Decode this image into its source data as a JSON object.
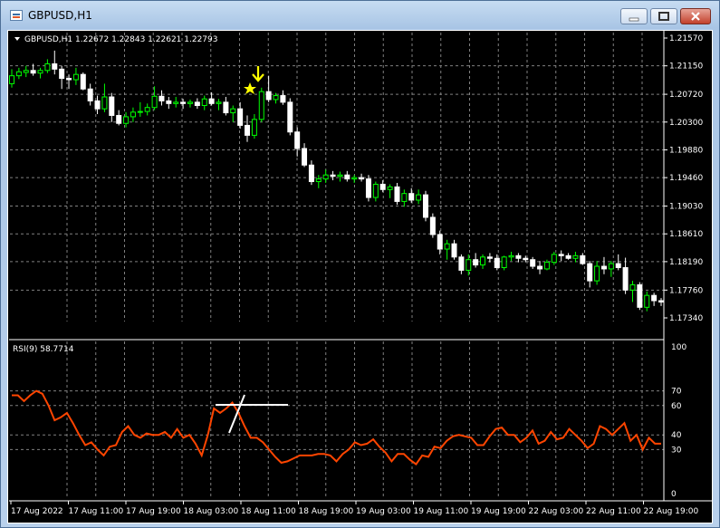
{
  "window": {
    "title": "GBPUSD,H1"
  },
  "main_panel": {
    "label": "GBPUSD,H1  1.22672 1.22843 1.22621 1.22793"
  },
  "rsi_panel": {
    "label": "RSI(9) 58.7714"
  },
  "colors": {
    "background": "#000000",
    "grid": "#808080",
    "bull": "#00ff00",
    "bear": "#ffffff",
    "rsi_line": "#ff4500",
    "arrow": "#ffff00"
  },
  "icons": {
    "signal_arrow": "arrow-down-icon",
    "signal_star": "star-icon",
    "minimize": "minimize-icon",
    "maximize": "maximize-icon",
    "close": "close-icon"
  },
  "price_axis": [
    "1.21570",
    "1.21150",
    "1.20720",
    "1.20300",
    "1.19880",
    "1.19460",
    "1.19030",
    "1.18610",
    "1.18190",
    "1.17760",
    "1.17340"
  ],
  "rsi_axis": [
    "100",
    "70",
    "60",
    "40",
    "30",
    "0"
  ],
  "time_axis": [
    "17 Aug 2022",
    "17 Aug 11:00",
    "17 Aug 19:00",
    "18 Aug 03:00",
    "18 Aug 11:00",
    "18 Aug 19:00",
    "19 Aug 03:00",
    "19 Aug 11:00",
    "19 Aug 19:00",
    "22 Aug 03:00",
    "22 Aug 11:00",
    "22 Aug 19:00"
  ],
  "chart_data": [
    {
      "type": "candlestick",
      "title": "GBPUSD,H1",
      "ylim": [
        1.1734,
        1.2157
      ],
      "candles": [
        [
          1.2088,
          1.211,
          1.2082,
          1.21
        ],
        [
          1.21,
          1.2112,
          1.2095,
          1.2106
        ],
        [
          1.2105,
          1.2115,
          1.2098,
          1.2108
        ],
        [
          1.2108,
          1.2118,
          1.21,
          1.2104
        ],
        [
          1.2104,
          1.2112,
          1.2096,
          1.2108
        ],
        [
          1.2108,
          1.2125,
          1.2104,
          1.2118
        ],
        [
          1.2118,
          1.2138,
          1.2102,
          1.211
        ],
        [
          1.211,
          1.2115,
          1.208,
          1.2096
        ],
        [
          1.2096,
          1.2102,
          1.208,
          1.2094
        ],
        [
          1.2094,
          1.2112,
          1.2086,
          1.2102
        ],
        [
          1.2102,
          1.2105,
          1.2078,
          1.208
        ],
        [
          1.208,
          1.2088,
          1.2055,
          1.2062
        ],
        [
          1.2062,
          1.207,
          1.2042,
          1.205
        ],
        [
          1.205,
          1.2088,
          1.2045,
          1.2068
        ],
        [
          1.2068,
          1.2074,
          1.203,
          1.204
        ],
        [
          1.204,
          1.2048,
          1.2025,
          1.2028
        ],
        [
          1.2028,
          1.2045,
          1.2022,
          1.2038
        ],
        [
          1.2038,
          1.2052,
          1.203,
          1.2045
        ],
        [
          1.2045,
          1.206,
          1.2038,
          1.2046
        ],
        [
          1.2046,
          1.2058,
          1.204,
          1.2052
        ],
        [
          1.2052,
          1.2084,
          1.2048,
          1.2069
        ],
        [
          1.2069,
          1.2078,
          1.2055,
          1.2062
        ],
        [
          1.2062,
          1.2068,
          1.205,
          1.2058
        ],
        [
          1.2058,
          1.2068,
          1.2052,
          1.206
        ],
        [
          1.206,
          1.2065,
          1.205,
          1.2058
        ],
        [
          1.2058,
          1.2064,
          1.2052,
          1.206
        ],
        [
          1.206,
          1.2066,
          1.205,
          1.2055
        ],
        [
          1.2055,
          1.207,
          1.2048,
          1.2065
        ],
        [
          1.2065,
          1.2075,
          1.2055,
          1.2058
        ],
        [
          1.2058,
          1.2065,
          1.2048,
          1.206
        ],
        [
          1.206,
          1.2068,
          1.204,
          1.2044
        ],
        [
          1.2044,
          1.2055,
          1.203,
          1.205
        ],
        [
          1.205,
          1.206,
          1.202,
          1.2025
        ],
        [
          1.2025,
          1.204,
          1.2,
          1.201
        ],
        [
          1.201,
          1.2042,
          1.2005,
          1.2034
        ],
        [
          1.2034,
          1.2082,
          1.203,
          1.2076
        ],
        [
          1.2076,
          1.21,
          1.206,
          1.2064
        ],
        [
          1.2064,
          1.2074,
          1.2058,
          1.207
        ],
        [
          1.207,
          1.2078,
          1.2056,
          1.206
        ],
        [
          1.206,
          1.2066,
          1.201,
          1.2015
        ],
        [
          1.2015,
          1.2022,
          1.1978,
          1.199
        ],
        [
          1.199,
          1.1998,
          1.1962,
          1.1965
        ],
        [
          1.1965,
          1.1972,
          1.1935,
          1.194
        ],
        [
          1.194,
          1.195,
          1.193,
          1.1944
        ],
        [
          1.1944,
          1.1958,
          1.1938,
          1.195
        ],
        [
          1.195,
          1.1956,
          1.1942,
          1.1948
        ],
        [
          1.1948,
          1.1955,
          1.194,
          1.195
        ],
        [
          1.195,
          1.1956,
          1.194,
          1.1944
        ],
        [
          1.1944,
          1.195,
          1.1938,
          1.1946
        ],
        [
          1.1946,
          1.1952,
          1.194,
          1.1944
        ],
        [
          1.1944,
          1.195,
          1.191,
          1.1916
        ],
        [
          1.1916,
          1.194,
          1.191,
          1.1936
        ],
        [
          1.1936,
          1.1942,
          1.1924,
          1.1928
        ],
        [
          1.1928,
          1.1936,
          1.1915,
          1.1932
        ],
        [
          1.1932,
          1.1938,
          1.1905,
          1.191
        ],
        [
          1.191,
          1.1928,
          1.1902,
          1.1922
        ],
        [
          1.1922,
          1.193,
          1.1908,
          1.1912
        ],
        [
          1.1912,
          1.1928,
          1.1906,
          1.192
        ],
        [
          1.192,
          1.1926,
          1.188,
          1.1886
        ],
        [
          1.1886,
          1.1892,
          1.1855,
          1.186
        ],
        [
          1.186,
          1.1866,
          1.183,
          1.1838
        ],
        [
          1.1838,
          1.1852,
          1.1822,
          1.1846
        ],
        [
          1.1846,
          1.1852,
          1.1822,
          1.1826
        ],
        [
          1.1826,
          1.183,
          1.18,
          1.1806
        ],
        [
          1.1806,
          1.183,
          1.1798,
          1.1822
        ],
        [
          1.1822,
          1.1832,
          1.181,
          1.1814
        ],
        [
          1.1814,
          1.183,
          1.1808,
          1.1826
        ],
        [
          1.1826,
          1.1832,
          1.1818,
          1.1824
        ],
        [
          1.1824,
          1.183,
          1.1806,
          1.181
        ],
        [
          1.181,
          1.1828,
          1.1806,
          1.1826
        ],
        [
          1.1826,
          1.1834,
          1.182,
          1.1828
        ],
        [
          1.1828,
          1.1832,
          1.1818,
          1.1824
        ],
        [
          1.1824,
          1.1828,
          1.1818,
          1.1822
        ],
        [
          1.1822,
          1.1826,
          1.1808,
          1.1812
        ],
        [
          1.1812,
          1.182,
          1.18,
          1.1808
        ],
        [
          1.1808,
          1.1822,
          1.1806,
          1.1818
        ],
        [
          1.1818,
          1.1834,
          1.1814,
          1.183
        ],
        [
          1.183,
          1.1836,
          1.182,
          1.1828
        ],
        [
          1.1828,
          1.1832,
          1.1822,
          1.1824
        ],
        [
          1.1824,
          1.1834,
          1.1818,
          1.1828
        ],
        [
          1.1828,
          1.1832,
          1.1814,
          1.1816
        ],
        [
          1.1816,
          1.182,
          1.178,
          1.179
        ],
        [
          1.179,
          1.182,
          1.1784,
          1.1812
        ],
        [
          1.1812,
          1.1826,
          1.18,
          1.1808
        ],
        [
          1.1808,
          1.182,
          1.1796,
          1.1816
        ],
        [
          1.1816,
          1.183,
          1.1806,
          1.181
        ],
        [
          1.181,
          1.1825,
          1.177,
          1.1776
        ],
        [
          1.1776,
          1.179,
          1.1758,
          1.1784
        ],
        [
          1.1784,
          1.1788,
          1.1746,
          1.175
        ],
        [
          1.175,
          1.1774,
          1.1744,
          1.1768
        ],
        [
          1.1768,
          1.1772,
          1.1752,
          1.176
        ],
        [
          1.176,
          1.1764,
          1.1752,
          1.1758
        ]
      ]
    },
    {
      "type": "line",
      "title": "RSI(9) 58.7714",
      "ylim": [
        0,
        100
      ],
      "levels": [
        70,
        60,
        40,
        30
      ],
      "values": [
        67,
        67,
        63,
        67,
        70,
        68,
        60,
        50,
        52,
        55,
        48,
        40,
        33,
        35,
        30,
        26,
        32,
        33,
        42,
        46,
        40,
        38,
        41,
        40,
        40,
        42,
        38,
        44,
        38,
        40,
        34,
        26,
        40,
        58,
        55,
        58,
        62,
        55,
        46,
        38,
        38,
        35,
        30,
        25,
        21,
        22,
        24,
        26,
        26,
        26,
        27,
        27,
        26,
        22,
        27,
        30,
        35,
        33,
        34,
        37,
        32,
        28,
        22,
        27,
        27,
        23,
        20,
        26,
        25,
        32,
        31,
        36,
        39,
        40,
        39,
        38,
        33,
        33,
        39,
        44,
        45,
        40,
        40,
        35,
        38,
        43,
        34,
        36,
        42,
        37,
        38,
        44,
        40,
        36,
        31,
        34,
        46,
        44,
        40,
        44,
        48,
        36,
        40,
        30,
        38,
        34,
        34
      ]
    }
  ]
}
